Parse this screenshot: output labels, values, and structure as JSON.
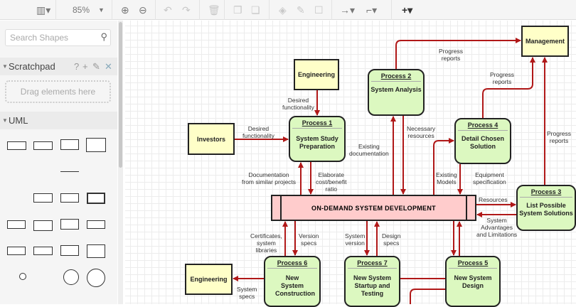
{
  "toolbar": {
    "zoom": "85%",
    "items": [
      "format-panel",
      "zoom-in",
      "zoom-out",
      "undo",
      "redo",
      "delete",
      "to-front",
      "to-back",
      "fill-color",
      "line-color",
      "shadow",
      "connection",
      "waypoints",
      "insert"
    ]
  },
  "sidebar": {
    "search_placeholder": "Search Shapes",
    "scratchpad": {
      "title": "Scratchpad",
      "help": "?",
      "drop_hint": "Drag elements here"
    },
    "uml": {
      "title": "UML"
    }
  },
  "diagram": {
    "colors": {
      "arrow": "#b01818",
      "process_fill": "#dcf8c0",
      "entity_fill": "#ffffc8",
      "store_fill": "#ffcccc"
    },
    "entities": {
      "engineering_top": "Engineering",
      "investors": "Investors",
      "management": "Management",
      "engineering_bottom": "Engineering"
    },
    "processes": [
      {
        "id": "Process 1",
        "name": "System Study Preparation"
      },
      {
        "id": "Process 2",
        "name": "System Analysis"
      },
      {
        "id": "Process 4",
        "name": "Detail Chosen Solution"
      },
      {
        "id": "Process 3",
        "name": "List Possible System Solutions"
      },
      {
        "id": "Process 6",
        "name": "New System Construction"
      },
      {
        "id": "Process 7",
        "name": "New System Startup and Testing"
      },
      {
        "id": "Process 5",
        "name": "New System Design"
      }
    ],
    "store": "ON-DEMAND SYSTEM DEVELOPMENT",
    "labels": {
      "desired1": "Desired\nfunctionality",
      "desired2": "Desired\nfunctionality",
      "progress1": "Progress\nreports",
      "progress2": "Progress\nreports",
      "progress3": "Progress\nreports",
      "docs": "Documentation\nfrom similar projects",
      "elaborate": "Elaborate\ncost/benefit\nratio",
      "existing_docs": "Existing\ndocumentation",
      "necessary": "Necessary\nresources",
      "existing_models": "Existing\nModels",
      "equipment": "Equipment\nspecification",
      "resources": "Resources",
      "advantages": "System\nAdvantages\nand Limitations",
      "certificates": "Certificates,\nsystem\nlibraries",
      "version_specs": "Version\nspecs",
      "system_version": "System\nversion",
      "design_specs": "Design\nspecs",
      "system_specs": "System\nspecs"
    }
  }
}
